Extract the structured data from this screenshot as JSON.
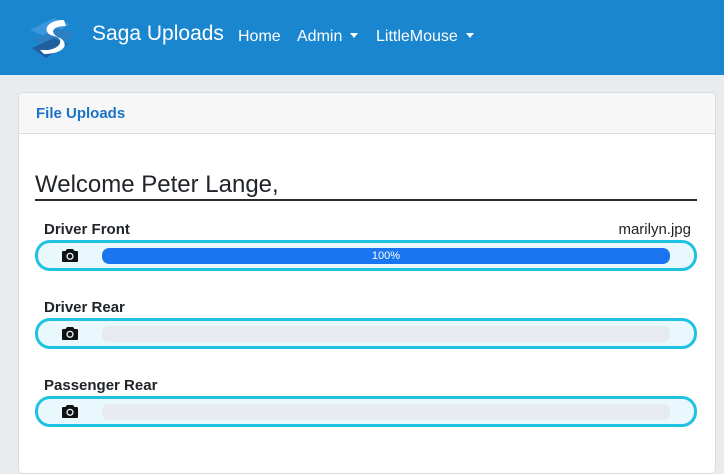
{
  "navbar": {
    "brand": "Saga Uploads",
    "links": [
      {
        "label": "Home"
      },
      {
        "label": "Admin",
        "dropdown": true
      },
      {
        "label": "LittleMouse",
        "dropdown": true
      }
    ],
    "logo_icon": "saga-s-logo-icon",
    "color": "#1a86d0"
  },
  "card": {
    "title": "File Uploads",
    "welcome": "Welcome Peter Lange,"
  },
  "uploads": [
    {
      "label": "Driver Front",
      "filename": "marilyn.jpg",
      "progress": 100,
      "progress_text": "100%"
    },
    {
      "label": "Driver Rear",
      "filename": "",
      "progress": 0,
      "progress_text": ""
    },
    {
      "label": "Passenger Rear",
      "filename": "",
      "progress": 0,
      "progress_text": ""
    }
  ],
  "colors": {
    "accent": "#1fc2e2",
    "progress_fill": "#1976f0",
    "header_text": "#1a73c9"
  },
  "icons": {
    "upload_trigger": "camera-icon"
  }
}
